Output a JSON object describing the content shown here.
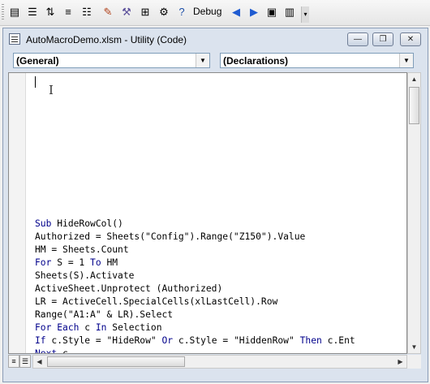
{
  "toolbar": {
    "icons": [
      "list-properties-icon",
      "list-constants-icon",
      "quick-info-icon",
      "parameter-info-icon",
      "complete-word-icon",
      "indent-icon",
      "outdent-icon",
      "toggle-breakpoint-icon",
      "comment-block-icon",
      "uncomment-block-icon",
      "toggle-bookmark-icon",
      "next-bookmark-icon",
      "help-icon"
    ],
    "debug_label": "Debug"
  },
  "window": {
    "title": "AutoMacroDemo.xlsm - Utility (Code)",
    "minimize_glyph": "—",
    "restore_glyph": "❐",
    "close_glyph": "✕"
  },
  "object_combo": {
    "value": "(General)"
  },
  "procedure_combo": {
    "value": "(Declarations)"
  },
  "code": {
    "lines": [
      "Sub HideRowCol()",
      "Authorized = Sheets(\"Config\").Range(\"Z150\").Value",
      "HM = Sheets.Count",
      "For S = 1 To HM",
      "Sheets(S).Activate",
      "ActiveSheet.Unprotect (Authorized)",
      "LR = ActiveCell.SpecialCells(xlLastCell).Row",
      "Range(\"A1:A\" & LR).Select",
      "For Each c In Selection",
      "If c.Style = \"HideRow\" Or c.Style = \"HiddenRow\" Then c.Ent",
      "Next c"
    ]
  },
  "colors": {
    "keyword": "#00008b",
    "title_bg": "#dbe3ee"
  }
}
